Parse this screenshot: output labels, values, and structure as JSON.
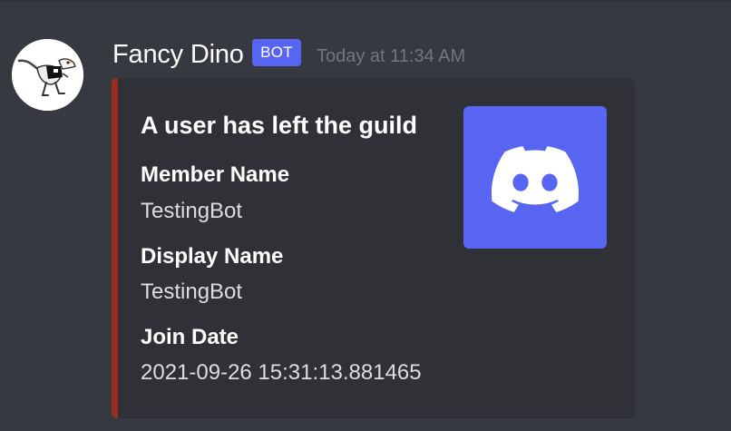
{
  "message": {
    "author": "Fancy Dino",
    "bot_tag": "BOT",
    "timestamp": "Today at 11:34 AM",
    "avatar_icon": "dinosaur-avatar-icon"
  },
  "embed": {
    "accent_color": "#992d22",
    "title": "A user has left the guild",
    "thumbnail_icon": "discord-logo-icon",
    "fields": [
      {
        "name": "Member Name",
        "value": "TestingBot"
      },
      {
        "name": "Display Name",
        "value": "TestingBot"
      },
      {
        "name": "Join Date",
        "value": "2021-09-26 15:31:13.881465"
      }
    ]
  },
  "colors": {
    "background": "#36393f",
    "embed_background": "#2f3136",
    "blurple": "#5865f2",
    "timestamp": "#72767d"
  }
}
